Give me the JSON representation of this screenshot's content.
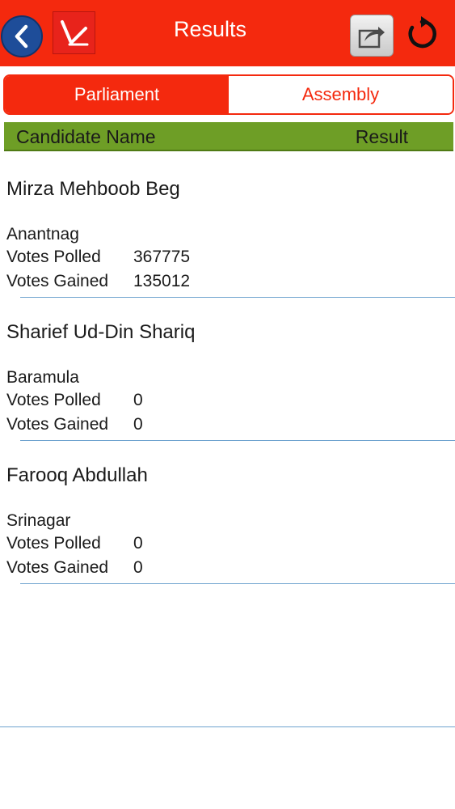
{
  "header": {
    "title": "Results",
    "back_icon": "chevron-left-icon",
    "logo_icon": "app-logo-icon",
    "share_icon": "share-icon",
    "refresh_icon": "refresh-icon",
    "accent_color": "#f4290e"
  },
  "tabs": [
    {
      "label": "Parliament",
      "active": true
    },
    {
      "label": "Assembly",
      "active": false
    }
  ],
  "table_header": {
    "candidate_name": "Candidate Name",
    "result": "Result",
    "color": "#6e9e26"
  },
  "results": [
    {
      "name": "Mirza Mehboob Beg",
      "constituency": "Anantnag",
      "votes_polled_label": "Votes Polled",
      "votes_polled": "367775",
      "votes_gained_label": "Votes Gained",
      "votes_gained": "135012"
    },
    {
      "name": "Sharief Ud-Din Shariq",
      "constituency": "Baramula",
      "votes_polled_label": "Votes Polled",
      "votes_polled": "0",
      "votes_gained_label": "Votes Gained",
      "votes_gained": "0"
    },
    {
      "name": "Farooq Abdullah",
      "constituency": "Srinagar",
      "votes_polled_label": "Votes Polled",
      "votes_polled": "0",
      "votes_gained_label": "Votes Gained",
      "votes_gained": "0"
    }
  ]
}
